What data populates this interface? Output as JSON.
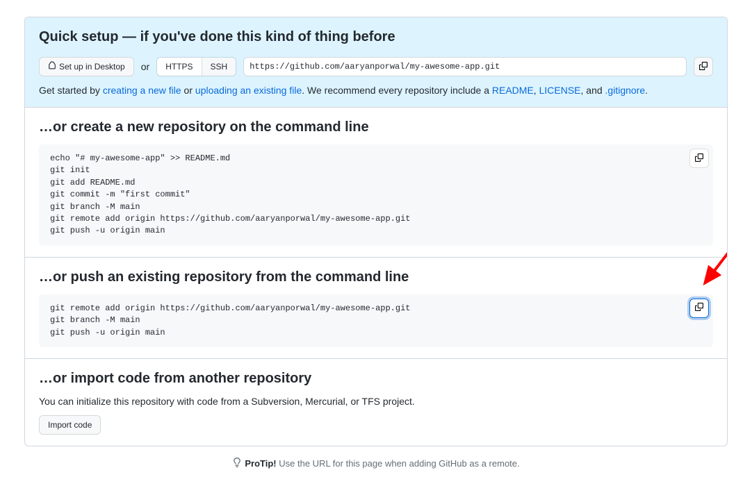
{
  "quick_setup": {
    "heading": "Quick setup — if you've done this kind of thing before",
    "setup_desktop_label": "Set up in Desktop",
    "or_text": "or",
    "https_label": "HTTPS",
    "ssh_label": "SSH",
    "repo_url": "https://github.com/aaryanporwal/my-awesome-app.git",
    "get_started_prefix": "Get started by ",
    "creating_file_link": "creating a new file",
    "or_text2": " or ",
    "uploading_link": "uploading an existing file",
    "recommend_text": ". We recommend every repository include a ",
    "readme_link": "README",
    "comma1": ", ",
    "license_link": "LICENSE",
    "and_text": ", and ",
    "gitignore_link": ".gitignore",
    "period": "."
  },
  "create_repo": {
    "heading": "…or create a new repository on the command line",
    "code": "echo \"# my-awesome-app\" >> README.md\ngit init\ngit add README.md\ngit commit -m \"first commit\"\ngit branch -M main\ngit remote add origin https://github.com/aaryanporwal/my-awesome-app.git\ngit push -u origin main"
  },
  "push_repo": {
    "heading": "…or push an existing repository from the command line",
    "code": "git remote add origin https://github.com/aaryanporwal/my-awesome-app.git\ngit branch -M main\ngit push -u origin main"
  },
  "import_repo": {
    "heading": "…or import code from another repository",
    "description": "You can initialize this repository with code from a Subversion, Mercurial, or TFS project.",
    "button_label": "Import code"
  },
  "protip": {
    "label": "ProTip!",
    "text": " Use the URL for this page when adding GitHub as a remote."
  }
}
